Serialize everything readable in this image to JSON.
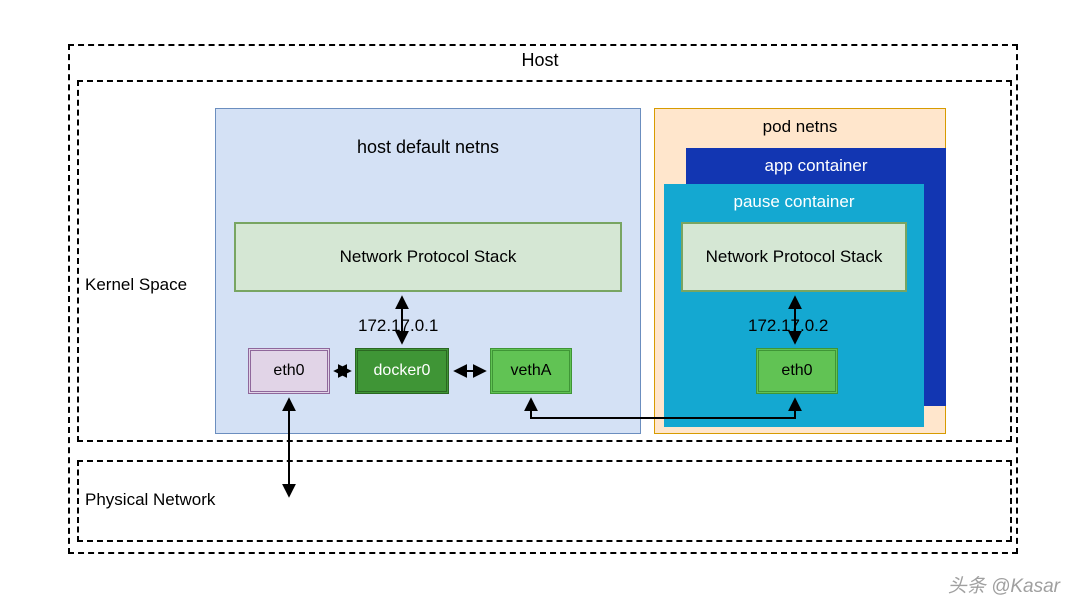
{
  "title": "Host",
  "kernel_space_label": "Kernel Space",
  "physical_label": "Physical Network",
  "host_netns_title": "host default netns",
  "pod_netns_title": "pod netns",
  "app_container_label": "app container",
  "pause_container_label": "pause container",
  "stack_host": "Network Protocol Stack",
  "stack_pod": "Network Protocol Stack",
  "ip1": "172.17.0.1",
  "ip2": "172.17.0.2",
  "interfaces": {
    "eth0_host": "eth0",
    "docker0": "docker0",
    "vethA": "vethA",
    "eth0_pod": "eth0"
  },
  "watermark": "头条 @Kasar"
}
